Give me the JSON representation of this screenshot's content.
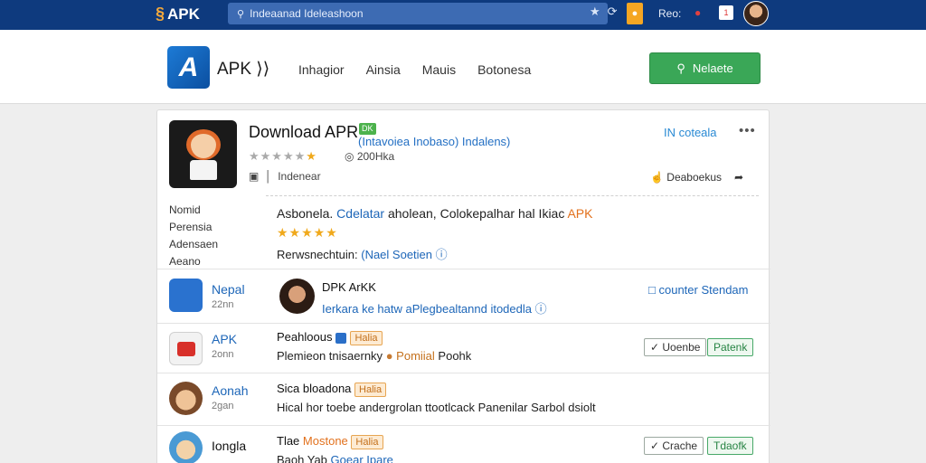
{
  "topbar": {
    "logo_text": "APK",
    "search_text": "Indeaanad Ideleashoon",
    "label": "Reo:",
    "notif_count": "1"
  },
  "header": {
    "brand": "APK",
    "nav": [
      "Inhagior",
      "Ainsia",
      "Mauis",
      "Botonesa"
    ],
    "cta": "Nelaete"
  },
  "app": {
    "title": "Download APR",
    "tag": "DK",
    "subtitle": "(Intavoiea Inobaso) Indalens)",
    "rating_value": "200Hka",
    "language": "Indenear",
    "right_link": "IN coteala",
    "share_label": "Deaboekus",
    "labels": [
      "Nomid",
      "Perensia",
      "Adensaen",
      "Aeano"
    ],
    "desc1_a": "Asbonela.",
    "desc1_b": "Cdelatar",
    "desc1_c": "aholean, Colokepalhar hal Ikiac",
    "desc1_d": "APK",
    "desc2_a": "Rerwsnechtuin:",
    "desc2_b": "(Nael Soetien"
  },
  "rows": [
    {
      "name": "Nepal",
      "size": "22nn",
      "title": "DPK ArKK",
      "text": "Ierkara ke hatw aPlegbealtannd itodedla",
      "link": "counter Stendam"
    },
    {
      "name": "APK",
      "size": "2onn",
      "title": "Peahloous",
      "badge": "Halia",
      "text_a": "Plemieon tnisaernky",
      "text_b": "Pomiial",
      "text_c": "Poohk",
      "btn1": "Uoenbe",
      "btn2": "Patenk"
    },
    {
      "name": "Aonah",
      "size": "2gan",
      "title": "Sica bloadona",
      "badge": "Halia",
      "text": "Hical hor toebe andergrolan ttootlcack Panenilar Sarbol dsiolt"
    },
    {
      "name": "Iongla",
      "title_a": "Tlae",
      "title_b": "Mostone",
      "badge": "Halia",
      "text_a": "Baoh Yab",
      "text_b": "Goear Ipare",
      "btn1": "Crache",
      "btn2": "Tdaofk"
    }
  ]
}
